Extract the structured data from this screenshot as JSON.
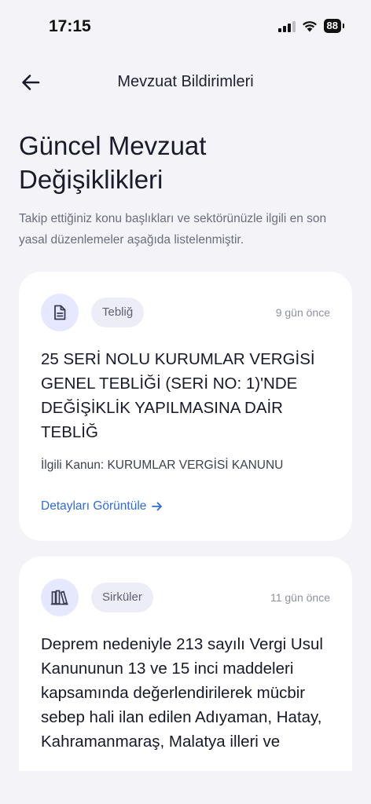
{
  "status_bar": {
    "time": "17:15",
    "battery": "88"
  },
  "header": {
    "title": "Mevzuat Bildirimleri"
  },
  "page": {
    "heading": "Güncel Mevzuat Değişiklikleri",
    "description": "Takip ettiğiniz konu başlıkları ve sektörünüzle ilgili en son yasal düzenlemeler aşağıda listelenmiştir."
  },
  "cards": [
    {
      "icon": "document-icon",
      "badge": "Tebliğ",
      "time_ago": "9 gün önce",
      "title": "25 SERİ NOLU KURUMLAR VERGİSİ GENEL TEBLİĞİ (SERİ NO: 1)'NDE DEĞİŞİKLİK YAPILMASINA DAİR TEBLİĞ",
      "law": "İlgili Kanun: KURUMLAR VERGİSİ KANUNU",
      "link": "Detayları Görüntüle"
    },
    {
      "icon": "books-icon",
      "badge": "Sirküler",
      "time_ago": "11 gün önce",
      "title": "Deprem nedeniyle 213 sayılı Vergi Usul Kanununun 13 ve 15 inci maddeleri kapsamında değerlendirilerek mücbir sebep hali ilan edilen Adıyaman, Hatay, Kahramanmaraş, Malatya illeri ve"
    }
  ],
  "colors": {
    "background": "#F3F3F8",
    "card": "#FFFFFF",
    "icon_circle": "#E6E8FF",
    "badge": "#ECEDF6",
    "link": "#2F6BD6"
  }
}
